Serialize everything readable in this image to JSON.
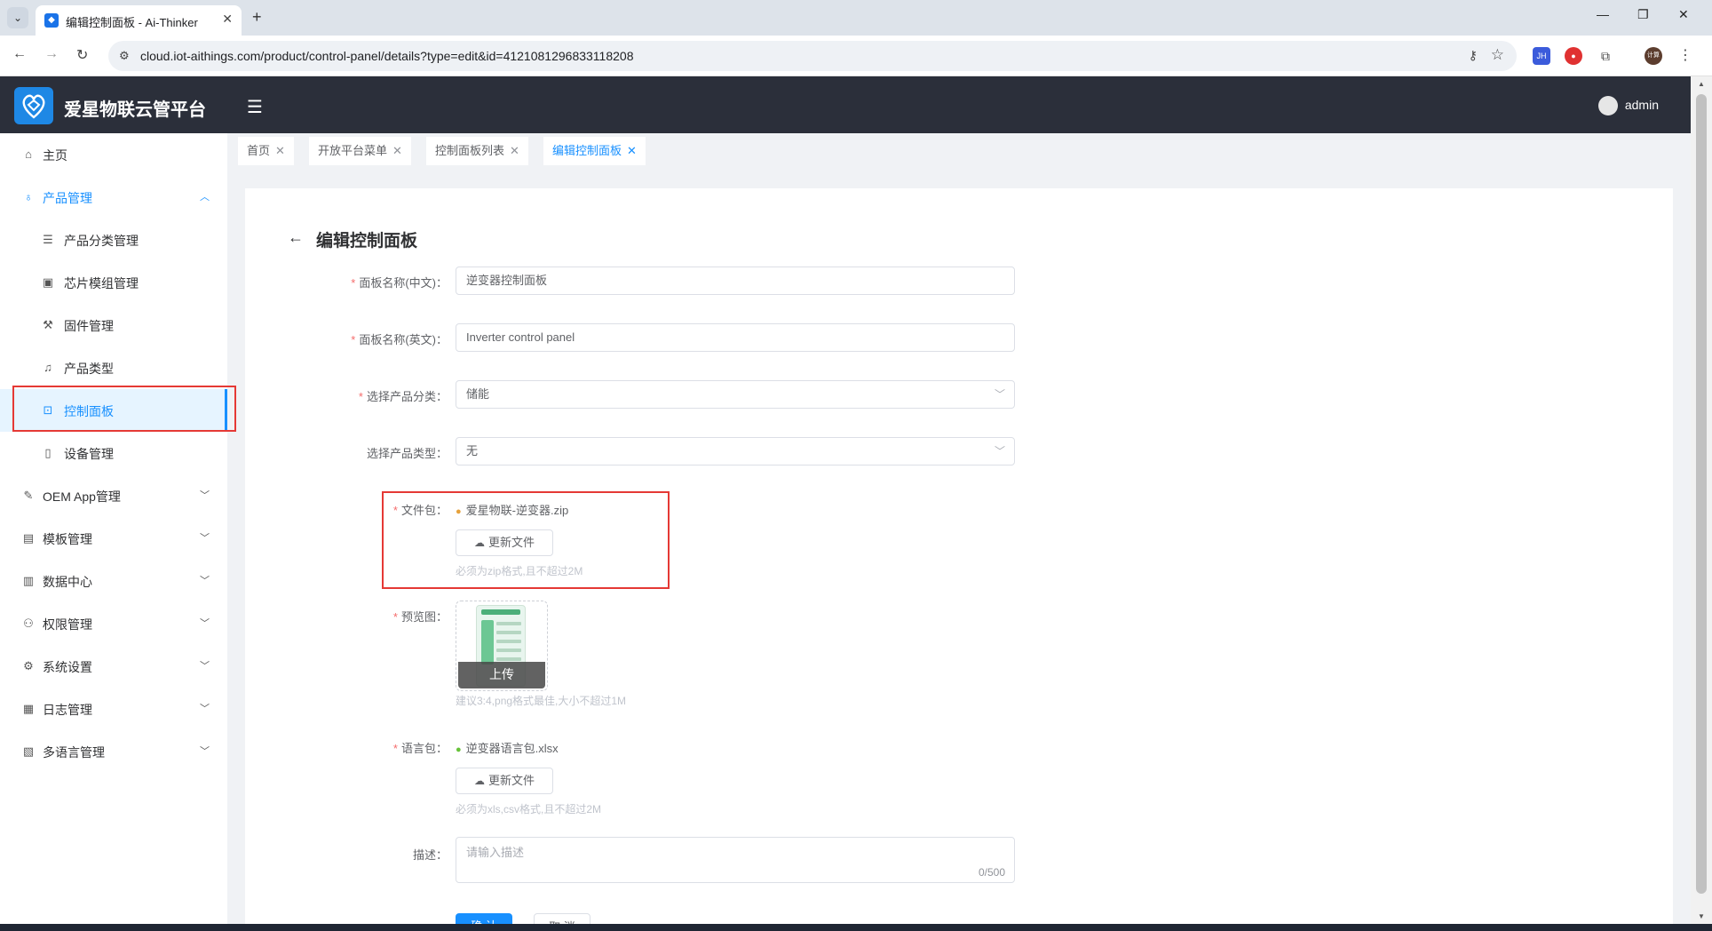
{
  "browser": {
    "tab_title": "编辑控制面板 - Ai-Thinker",
    "url": "cloud.iot-aithings.com/product/control-panel/details?type=edit&id=4121081296833118208",
    "extensions": [
      {
        "name": "jh-extension-icon",
        "label": "JH",
        "color": "#3b5bdb"
      },
      {
        "name": "shield-extension-icon",
        "label": "",
        "color": "#e03131"
      },
      {
        "name": "puzzle-icon",
        "label": "",
        "color": "#ffffff"
      },
      {
        "name": "profile-icon",
        "label": "计算",
        "color": "#5c3d2e"
      }
    ]
  },
  "header": {
    "brand": "爱星物联云管平台",
    "user": "admin"
  },
  "sidebar": {
    "items": [
      {
        "label": "主页",
        "icon": "home-icon"
      },
      {
        "label": "产品管理",
        "icon": "bulb-icon"
      },
      {
        "label": "产品分类管理",
        "icon": "list-icon"
      },
      {
        "label": "芯片模组管理",
        "icon": "chip-icon"
      },
      {
        "label": "固件管理",
        "icon": "wrench-icon"
      },
      {
        "label": "产品类型",
        "icon": "bell-icon"
      },
      {
        "label": "控制面板",
        "icon": "chart-icon"
      },
      {
        "label": "设备管理",
        "icon": "device-icon"
      },
      {
        "label": "OEM App管理",
        "icon": "pen-icon"
      },
      {
        "label": "模板管理",
        "icon": "doc-icon"
      },
      {
        "label": "数据中心",
        "icon": "bar-chart-icon"
      },
      {
        "label": "权限管理",
        "icon": "user-key-icon"
      },
      {
        "label": "系统设置",
        "icon": "gear-icon"
      },
      {
        "label": "日志管理",
        "icon": "log-icon"
      },
      {
        "label": "多语言管理",
        "icon": "book-icon"
      }
    ]
  },
  "tags": [
    {
      "label": "首页"
    },
    {
      "label": "开放平台菜单"
    },
    {
      "label": "控制面板列表"
    },
    {
      "label": "编辑控制面板"
    }
  ],
  "page": {
    "title": "编辑控制面板"
  },
  "form": {
    "name_cn_label": "面板名称(中文)",
    "name_cn_value": "逆变器控制面板",
    "name_en_label": "面板名称(英文)",
    "name_en_value": "Inverter control panel",
    "category_label": "选择产品分类",
    "category_value": "储能",
    "type_label": "选择产品类型",
    "type_value": "无",
    "file_label": "文件包",
    "file_name": "爱星物联-逆变器.zip",
    "file_button": "更新文件",
    "file_hint": "必须为zip格式,且不超过2M",
    "preview_label": "预览图",
    "preview_upload": "上传",
    "preview_hint": "建议3:4,png格式最佳,大小不超过1M",
    "lang_label": "语言包",
    "lang_file_name": "逆变器语言包.xlsx",
    "lang_button": "更新文件",
    "lang_hint": "必须为xls,csv格式,且不超过2M",
    "desc_label": "描述",
    "desc_placeholder": "请输入描述",
    "desc_count": "0/500",
    "submit": "确 认",
    "cancel": "取 消"
  },
  "colors": {
    "primary": "#1890ff",
    "header_bg": "#2b2f3a",
    "highlight": "#e53935"
  }
}
